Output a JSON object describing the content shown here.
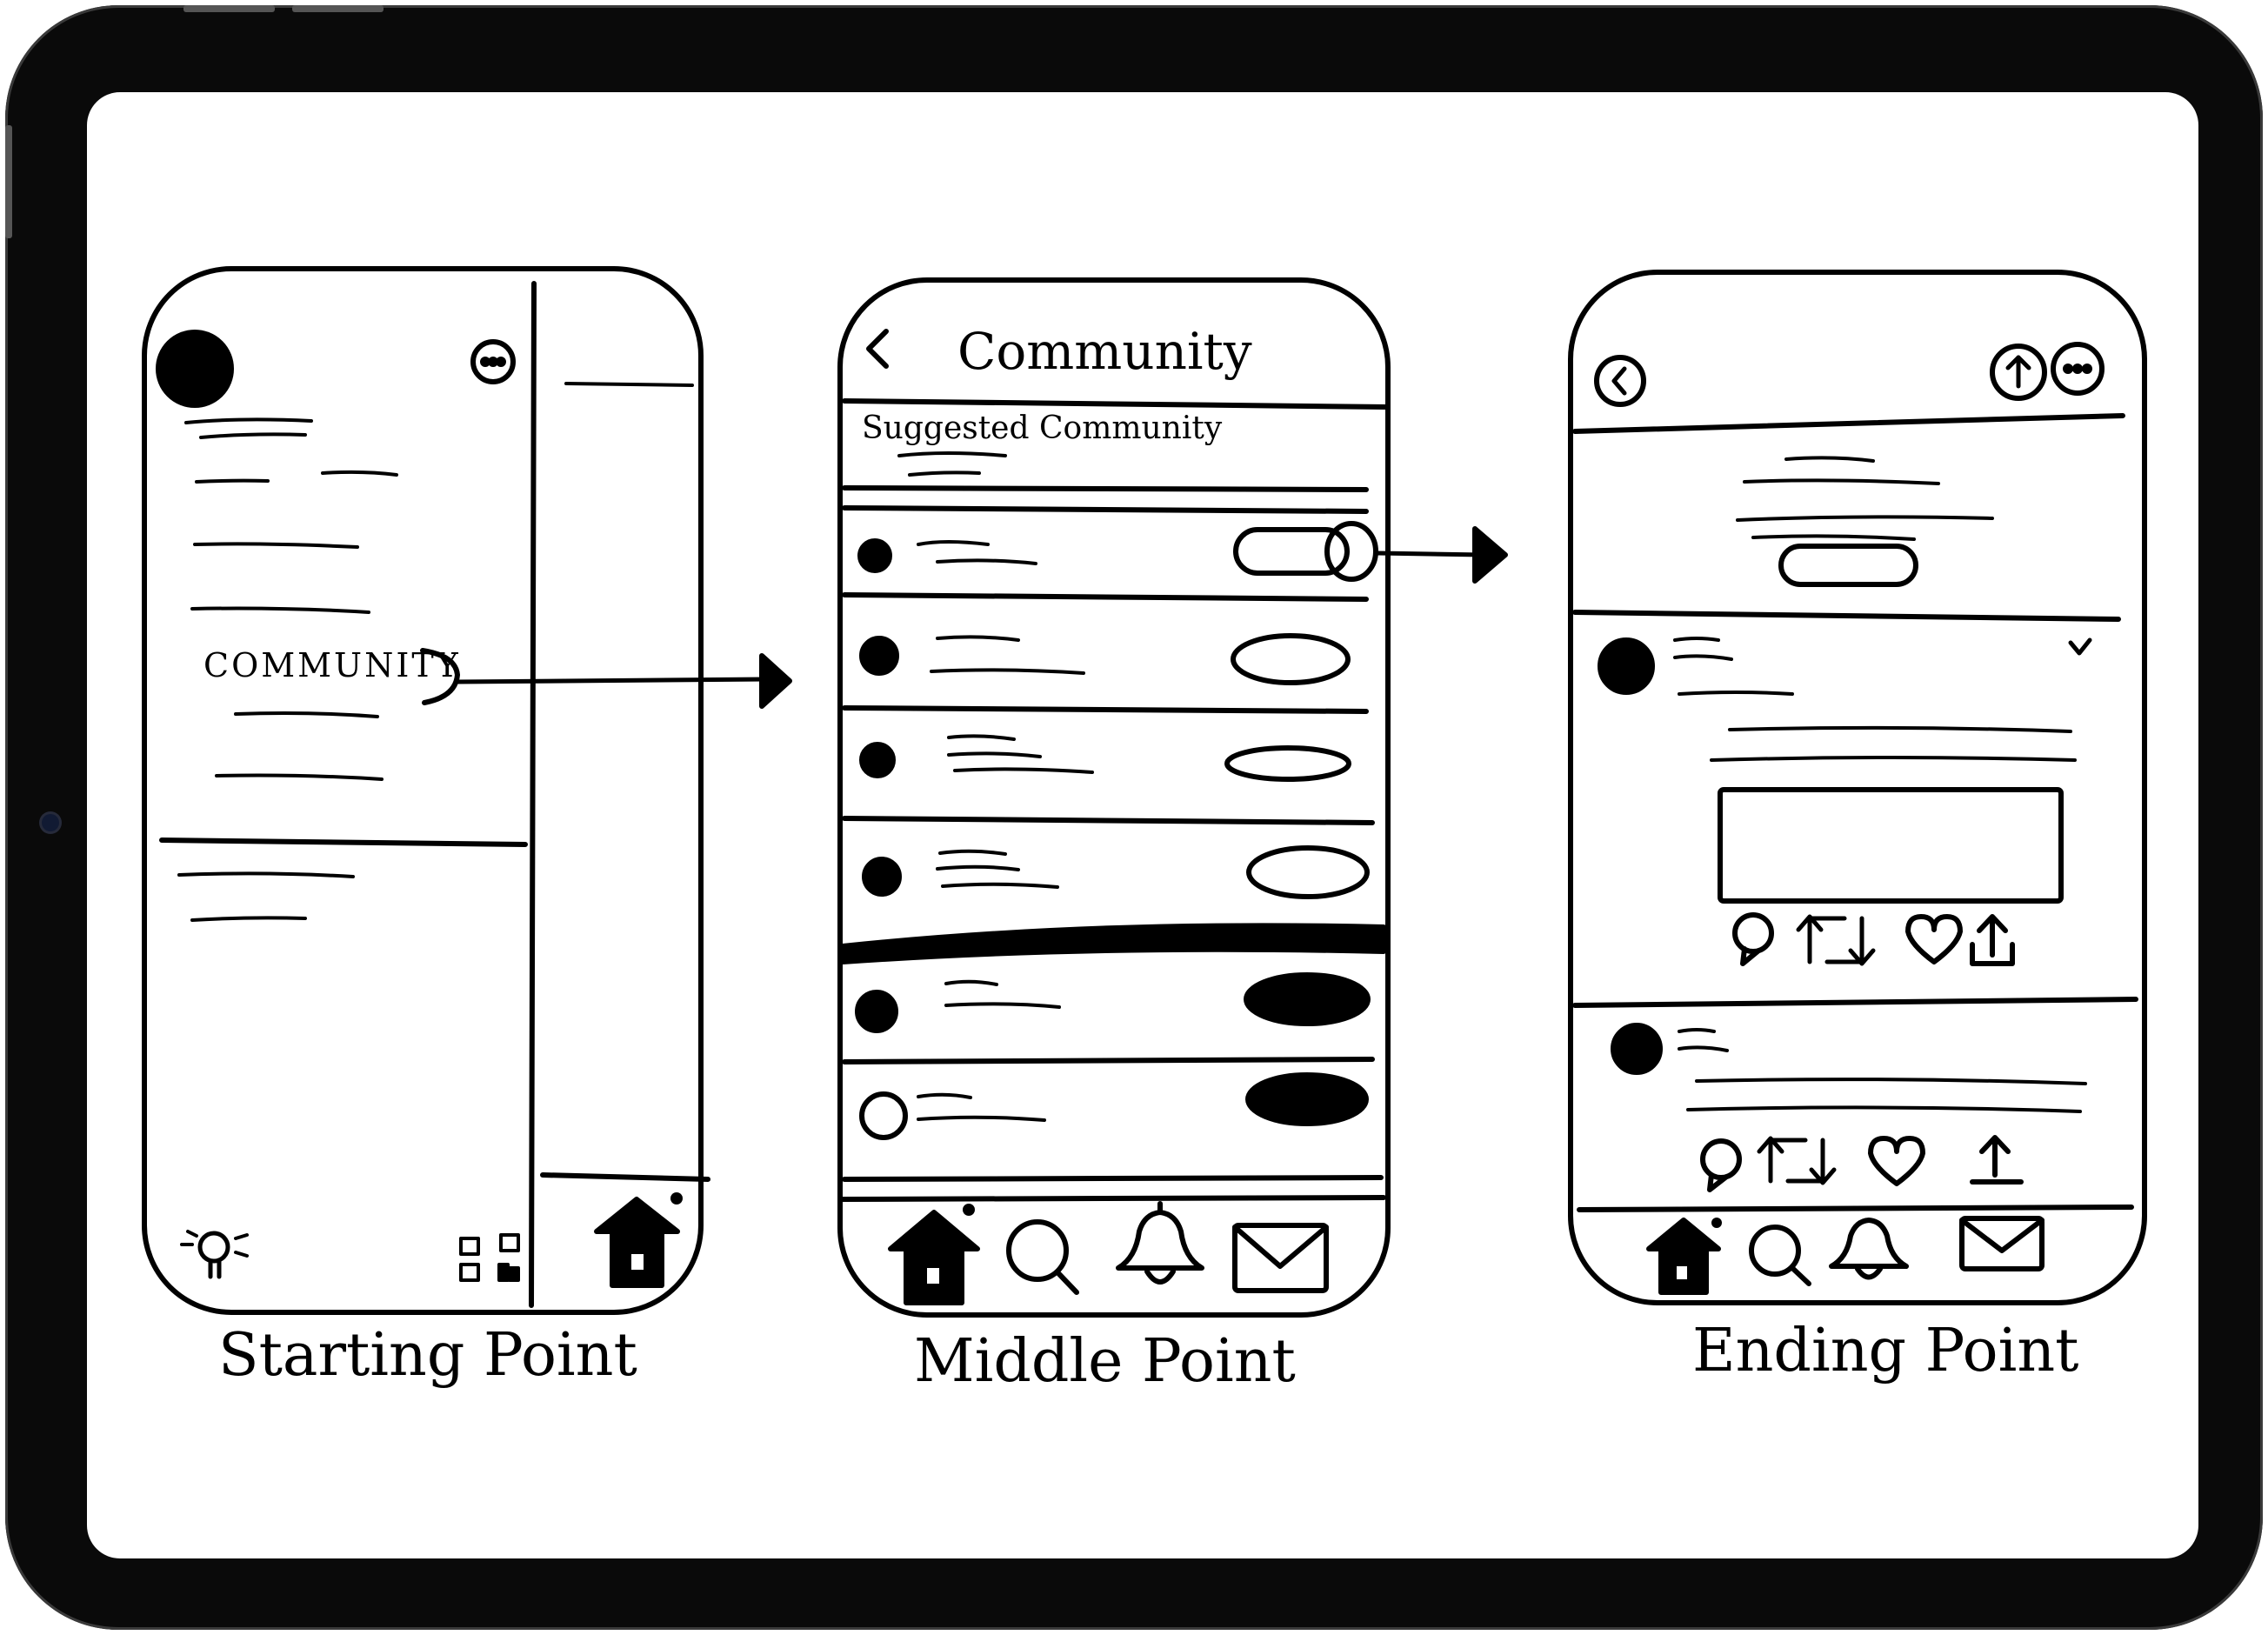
{
  "device": {
    "frame_color": "#0a0a0a",
    "screen_color": "#ffffff",
    "ink_color": "#000000"
  },
  "captions": {
    "starting": "Starting Point",
    "middle": "Middle Point",
    "ending": "Ending Point"
  },
  "screen1": {
    "menu_item_community": "COMMUNITY",
    "icons": [
      "avatar",
      "more-options-icon",
      "lightbulb-icon",
      "qr-code-icon",
      "home-icon"
    ]
  },
  "screen2": {
    "title": "Community",
    "subtitle": "Suggested Community",
    "rows": [
      {
        "avatar": "filled",
        "button": "outline"
      },
      {
        "avatar": "filled",
        "button": "outline"
      },
      {
        "avatar": "filled",
        "button": "outline"
      },
      {
        "avatar": "filled",
        "button": "outline"
      },
      {
        "avatar": "filled",
        "button": "filled"
      },
      {
        "avatar": "outline",
        "button": "filled"
      }
    ],
    "icons": [
      "back-icon",
      "home-icon",
      "search-icon",
      "bell-icon",
      "mail-icon"
    ]
  },
  "screen3": {
    "icons": [
      "back-icon",
      "share-icon",
      "more-options-icon",
      "reply-icon",
      "retweet-icon",
      "like-icon",
      "upload-icon",
      "home-icon",
      "search-icon",
      "bell-icon",
      "mail-icon"
    ]
  }
}
